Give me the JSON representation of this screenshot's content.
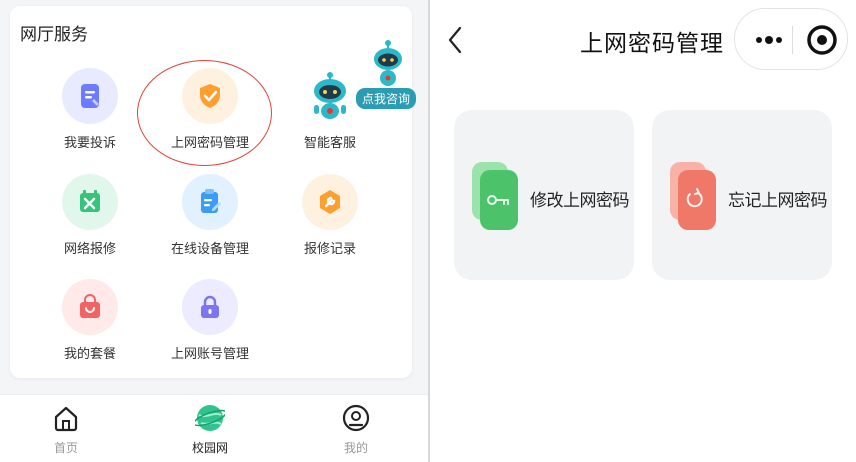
{
  "left": {
    "section_title": "网厅服务",
    "services": [
      {
        "label": "我要投诉",
        "icon": "complaint-doc-icon",
        "bg": "#e8eaff",
        "color": "#6c7bff"
      },
      {
        "label": "上网密码管理",
        "icon": "shield-check-icon",
        "bg": "#fff1e0",
        "color": "#ff9f2e"
      },
      {
        "label": "智能客服",
        "icon": "robot-icon",
        "bg": "#e0f7fa",
        "color": "#2bb9c9"
      },
      {
        "label": "网络报修",
        "icon": "repair-tools-icon",
        "bg": "#e2f7ec",
        "color": "#35c47a"
      },
      {
        "label": "在线设备管理",
        "icon": "clipboard-edit-icon",
        "bg": "#e2f1ff",
        "color": "#3b9cf3"
      },
      {
        "label": "报修记录",
        "icon": "wrench-hexagon-icon",
        "bg": "#fff1e0",
        "color": "#ff9f2e"
      },
      {
        "label": "我的套餐",
        "icon": "shopping-bag-icon",
        "bg": "#ffe9e9",
        "color": "#f26464"
      },
      {
        "label": "上网账号管理",
        "icon": "lock-icon",
        "bg": "#ecebff",
        "color": "#7b76f0"
      }
    ],
    "consult_tag": "点我咨询",
    "tabbar": [
      {
        "label": "首页",
        "icon": "home-icon"
      },
      {
        "label": "校园网",
        "icon": "globe-icon"
      },
      {
        "label": "我的",
        "icon": "profile-icon"
      }
    ],
    "active_tab": "校园网"
  },
  "right": {
    "title": "上网密码管理",
    "cards": [
      {
        "label": "修改上网密码",
        "icon": "key-card-icon",
        "color": "#4cc36a"
      },
      {
        "label": "忘记上网密码",
        "icon": "reset-card-icon",
        "color": "#f07868"
      }
    ]
  }
}
